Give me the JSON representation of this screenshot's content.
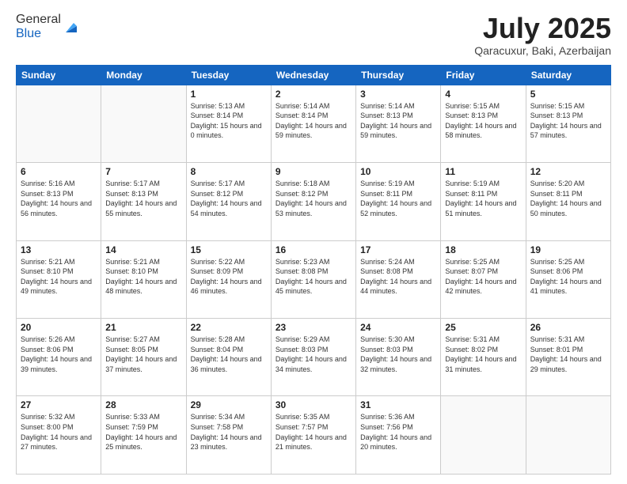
{
  "logo": {
    "general": "General",
    "blue": "Blue"
  },
  "header": {
    "month": "July 2025",
    "location": "Qaracuxur, Baki, Azerbaijan"
  },
  "weekdays": [
    "Sunday",
    "Monday",
    "Tuesday",
    "Wednesday",
    "Thursday",
    "Friday",
    "Saturday"
  ],
  "weeks": [
    [
      {
        "day": "",
        "empty": true
      },
      {
        "day": "",
        "empty": true
      },
      {
        "day": "1",
        "sunrise": "5:13 AM",
        "sunset": "8:14 PM",
        "daylight": "15 hours and 0 minutes."
      },
      {
        "day": "2",
        "sunrise": "5:14 AM",
        "sunset": "8:14 PM",
        "daylight": "14 hours and 59 minutes."
      },
      {
        "day": "3",
        "sunrise": "5:14 AM",
        "sunset": "8:13 PM",
        "daylight": "14 hours and 59 minutes."
      },
      {
        "day": "4",
        "sunrise": "5:15 AM",
        "sunset": "8:13 PM",
        "daylight": "14 hours and 58 minutes."
      },
      {
        "day": "5",
        "sunrise": "5:15 AM",
        "sunset": "8:13 PM",
        "daylight": "14 hours and 57 minutes."
      }
    ],
    [
      {
        "day": "6",
        "sunrise": "5:16 AM",
        "sunset": "8:13 PM",
        "daylight": "14 hours and 56 minutes."
      },
      {
        "day": "7",
        "sunrise": "5:17 AM",
        "sunset": "8:13 PM",
        "daylight": "14 hours and 55 minutes."
      },
      {
        "day": "8",
        "sunrise": "5:17 AM",
        "sunset": "8:12 PM",
        "daylight": "14 hours and 54 minutes."
      },
      {
        "day": "9",
        "sunrise": "5:18 AM",
        "sunset": "8:12 PM",
        "daylight": "14 hours and 53 minutes."
      },
      {
        "day": "10",
        "sunrise": "5:19 AM",
        "sunset": "8:11 PM",
        "daylight": "14 hours and 52 minutes."
      },
      {
        "day": "11",
        "sunrise": "5:19 AM",
        "sunset": "8:11 PM",
        "daylight": "14 hours and 51 minutes."
      },
      {
        "day": "12",
        "sunrise": "5:20 AM",
        "sunset": "8:11 PM",
        "daylight": "14 hours and 50 minutes."
      }
    ],
    [
      {
        "day": "13",
        "sunrise": "5:21 AM",
        "sunset": "8:10 PM",
        "daylight": "14 hours and 49 minutes."
      },
      {
        "day": "14",
        "sunrise": "5:21 AM",
        "sunset": "8:10 PM",
        "daylight": "14 hours and 48 minutes."
      },
      {
        "day": "15",
        "sunrise": "5:22 AM",
        "sunset": "8:09 PM",
        "daylight": "14 hours and 46 minutes."
      },
      {
        "day": "16",
        "sunrise": "5:23 AM",
        "sunset": "8:08 PM",
        "daylight": "14 hours and 45 minutes."
      },
      {
        "day": "17",
        "sunrise": "5:24 AM",
        "sunset": "8:08 PM",
        "daylight": "14 hours and 44 minutes."
      },
      {
        "day": "18",
        "sunrise": "5:25 AM",
        "sunset": "8:07 PM",
        "daylight": "14 hours and 42 minutes."
      },
      {
        "day": "19",
        "sunrise": "5:25 AM",
        "sunset": "8:06 PM",
        "daylight": "14 hours and 41 minutes."
      }
    ],
    [
      {
        "day": "20",
        "sunrise": "5:26 AM",
        "sunset": "8:06 PM",
        "daylight": "14 hours and 39 minutes."
      },
      {
        "day": "21",
        "sunrise": "5:27 AM",
        "sunset": "8:05 PM",
        "daylight": "14 hours and 37 minutes."
      },
      {
        "day": "22",
        "sunrise": "5:28 AM",
        "sunset": "8:04 PM",
        "daylight": "14 hours and 36 minutes."
      },
      {
        "day": "23",
        "sunrise": "5:29 AM",
        "sunset": "8:03 PM",
        "daylight": "14 hours and 34 minutes."
      },
      {
        "day": "24",
        "sunrise": "5:30 AM",
        "sunset": "8:03 PM",
        "daylight": "14 hours and 32 minutes."
      },
      {
        "day": "25",
        "sunrise": "5:31 AM",
        "sunset": "8:02 PM",
        "daylight": "14 hours and 31 minutes."
      },
      {
        "day": "26",
        "sunrise": "5:31 AM",
        "sunset": "8:01 PM",
        "daylight": "14 hours and 29 minutes."
      }
    ],
    [
      {
        "day": "27",
        "sunrise": "5:32 AM",
        "sunset": "8:00 PM",
        "daylight": "14 hours and 27 minutes."
      },
      {
        "day": "28",
        "sunrise": "5:33 AM",
        "sunset": "7:59 PM",
        "daylight": "14 hours and 25 minutes."
      },
      {
        "day": "29",
        "sunrise": "5:34 AM",
        "sunset": "7:58 PM",
        "daylight": "14 hours and 23 minutes."
      },
      {
        "day": "30",
        "sunrise": "5:35 AM",
        "sunset": "7:57 PM",
        "daylight": "14 hours and 21 minutes."
      },
      {
        "day": "31",
        "sunrise": "5:36 AM",
        "sunset": "7:56 PM",
        "daylight": "14 hours and 20 minutes."
      },
      {
        "day": "",
        "empty": true
      },
      {
        "day": "",
        "empty": true
      }
    ]
  ]
}
